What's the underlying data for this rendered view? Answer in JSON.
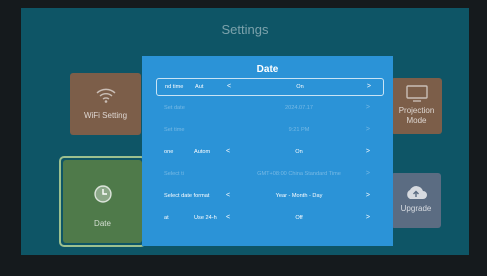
{
  "screen": {
    "title": "Settings"
  },
  "tiles": {
    "wifi": {
      "label": "WiFi Setting",
      "icon": "wifi-icon"
    },
    "date": {
      "label": "Date",
      "icon": "clock-icon"
    },
    "projection": {
      "label": "Projection Mode",
      "icon": "projector-icon"
    },
    "upgrade": {
      "label": "Upgrade",
      "icon": "cloud-upgrade-icon"
    }
  },
  "dialog": {
    "title": "Date",
    "rows": [
      {
        "label": "nd time",
        "mode": "Aut",
        "left_arrow": "<",
        "value": "On",
        "right_arrow": ">",
        "state": "highlighted"
      },
      {
        "label": "Set date",
        "mode": "",
        "left_arrow": "",
        "value": "2024.07.17",
        "right_arrow": ">",
        "state": "disabled"
      },
      {
        "label": "Set time",
        "mode": "",
        "left_arrow": "",
        "value": "9:21 PM",
        "right_arrow": ">",
        "state": "disabled"
      },
      {
        "label": "one",
        "mode": "Autom",
        "left_arrow": "<",
        "value": "On",
        "right_arrow": ">",
        "state": "normal"
      },
      {
        "label": "Select ti",
        "mode": "",
        "left_arrow": "",
        "value": "GMT+08:00 China Standard Time",
        "right_arrow": ">",
        "state": "disabled"
      },
      {
        "label": "Select date format",
        "mode": "",
        "left_arrow": "<",
        "value": "Year - Month - Day",
        "right_arrow": ">",
        "state": "normal"
      },
      {
        "label": "at",
        "mode": "Use 24-h",
        "left_arrow": "<",
        "value": "Off",
        "right_arrow": ">",
        "state": "normal"
      }
    ]
  },
  "colors": {
    "background": "#0e5566",
    "dialog": "#2b93d7",
    "tile_warm": "#7c5e49",
    "tile_green": "#4f7a4a",
    "tile_blue": "#5b6c82"
  }
}
